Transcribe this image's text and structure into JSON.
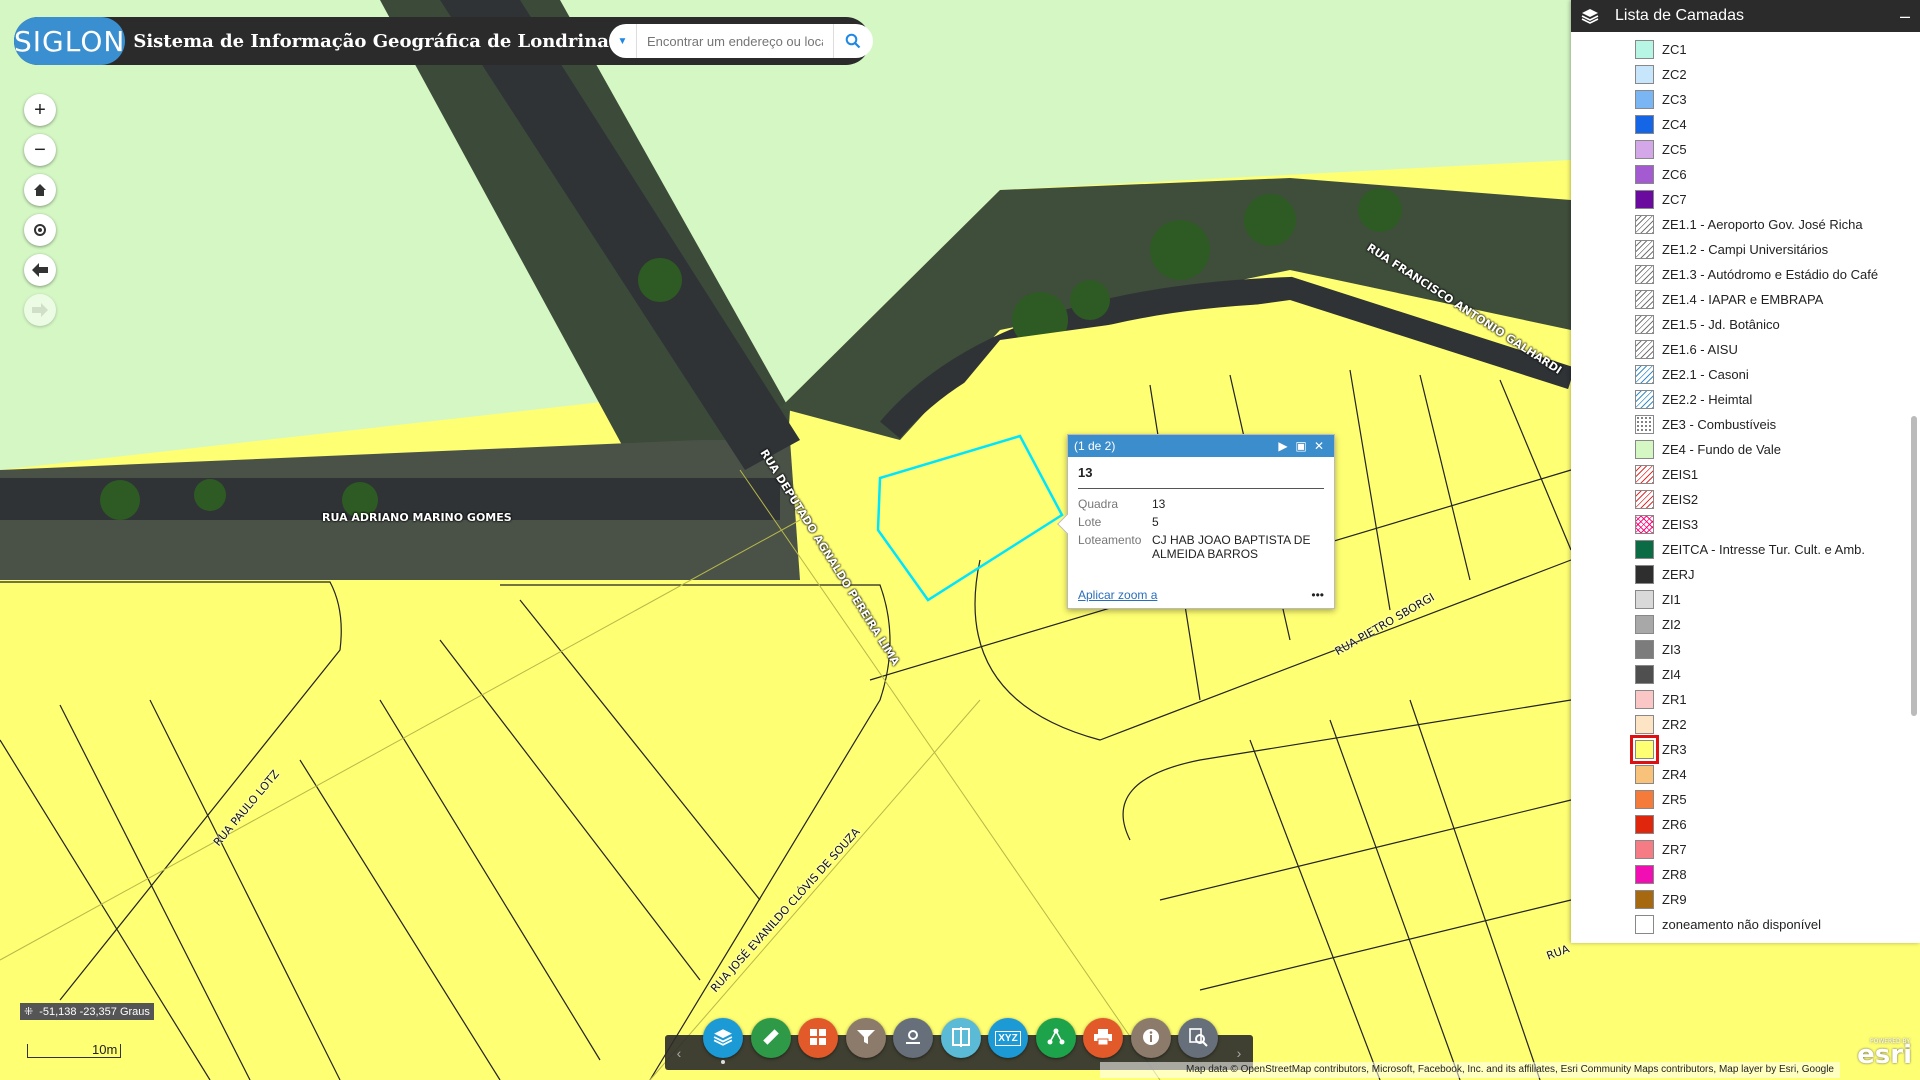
{
  "header": {
    "logo_text": "SIGLON",
    "app_title": "Sistema de Informação Geográfica de Londrina",
    "search_placeholder": "Encontrar um endereço ou local"
  },
  "map_tools": {
    "zoom_in": "+",
    "zoom_out": "−"
  },
  "street_labels": [
    "RUA ADRIANO MARINO GOMES",
    "RUA DEPUTADO AGNALDO PEREIRA LIMA",
    "RUA FRANCISCO ANTONIO GALHARDI",
    "RUA PIETRO SBORGI",
    "RUA PAULO LOTZ",
    "RUA JOSÉ EVANILDO CLÓVIS DE SOUZA",
    "RUA"
  ],
  "popup": {
    "counter": "(1 de 2)",
    "title": "13",
    "fields": [
      {
        "key": "Quadra",
        "value": "13"
      },
      {
        "key": "Lote",
        "value": "5"
      },
      {
        "key": "Loteamento",
        "value": "CJ HAB JOAO BAPTISTA DE ALMEIDA BARROS"
      }
    ],
    "zoom_link": "Aplicar zoom a",
    "more": "•••"
  },
  "layer_panel": {
    "title": "Lista de Camadas",
    "close": "–",
    "items": [
      {
        "label": "ZC1",
        "color": "#b7f5e4",
        "pattern": "solid"
      },
      {
        "label": "ZC2",
        "color": "#c8e6fb",
        "pattern": "solid"
      },
      {
        "label": "ZC3",
        "color": "#7ab6f4",
        "pattern": "solid"
      },
      {
        "label": "ZC4",
        "color": "#1466e6",
        "pattern": "solid"
      },
      {
        "label": "ZC5",
        "color": "#d3a7e8",
        "pattern": "solid"
      },
      {
        "label": "ZC6",
        "color": "#a45ad0",
        "pattern": "solid"
      },
      {
        "label": "ZC7",
        "color": "#6b0a9e",
        "pattern": "solid"
      },
      {
        "label": "ZE1.1 - Aeroporto Gov. José Richa",
        "color": "#ffffff",
        "pattern": "hatch"
      },
      {
        "label": "ZE1.2 - Campi Universitários",
        "color": "#ffffff",
        "pattern": "hatch"
      },
      {
        "label": "ZE1.3 - Autódromo e Estádio do Café",
        "color": "#ffffff",
        "pattern": "hatch"
      },
      {
        "label": "ZE1.4 - IAPAR e EMBRAPA",
        "color": "#ffffff",
        "pattern": "hatch"
      },
      {
        "label": "ZE1.5 - Jd. Botânico",
        "color": "#ffffff",
        "pattern": "hatch"
      },
      {
        "label": "ZE1.6 - AISU",
        "color": "#ffffff",
        "pattern": "hatch"
      },
      {
        "label": "ZE2.1 - Casoni",
        "color": "#ffffff",
        "pattern": "hatch-blue"
      },
      {
        "label": "ZE2.2 - Heimtal",
        "color": "#ffffff",
        "pattern": "hatch-blue"
      },
      {
        "label": "ZE3 - Combustíveis",
        "color": "#ffffff",
        "pattern": "dots"
      },
      {
        "label": "ZE4 - Fundo de Vale",
        "color": "#d4f7c4",
        "pattern": "solid"
      },
      {
        "label": "ZEIS1",
        "color": "#ffffff",
        "pattern": "hatch-red"
      },
      {
        "label": "ZEIS2",
        "color": "#ffffff",
        "pattern": "hatch-red"
      },
      {
        "label": "ZEIS3",
        "color": "#ffffff",
        "pattern": "hatch-pink"
      },
      {
        "label": "ZEITCA - Intresse Tur. Cult. e Amb.",
        "color": "#0b6b45",
        "pattern": "solid"
      },
      {
        "label": "ZERJ",
        "color": "#2e2e2e",
        "pattern": "solid"
      },
      {
        "label": "ZI1",
        "color": "#d9d9d9",
        "pattern": "solid"
      },
      {
        "label": "ZI2",
        "color": "#a8a8a8",
        "pattern": "solid"
      },
      {
        "label": "ZI3",
        "color": "#7c7c7c",
        "pattern": "solid"
      },
      {
        "label": "ZI4",
        "color": "#4f4f4f",
        "pattern": "solid"
      },
      {
        "label": "ZR1",
        "color": "#fbc6c6",
        "pattern": "solid"
      },
      {
        "label": "ZR2",
        "color": "#fde4c4",
        "pattern": "solid"
      },
      {
        "label": "ZR3",
        "color": "#ffff73",
        "pattern": "solid",
        "selected": true
      },
      {
        "label": "ZR4",
        "color": "#f8c27b",
        "pattern": "solid"
      },
      {
        "label": "ZR5",
        "color": "#f47b3a",
        "pattern": "solid"
      },
      {
        "label": "ZR6",
        "color": "#e0260d",
        "pattern": "solid"
      },
      {
        "label": "ZR7",
        "color": "#f57c84",
        "pattern": "solid"
      },
      {
        "label": "ZR8",
        "color": "#f10fb4",
        "pattern": "solid"
      },
      {
        "label": "ZR9",
        "color": "#a6690f",
        "pattern": "solid"
      },
      {
        "label": "zoneamento não disponível",
        "color": "#ffffff",
        "pattern": "solid"
      }
    ]
  },
  "status": {
    "coordinates": "-51,138 -23,357 Graus",
    "scale_label": "10m"
  },
  "toolbar": {
    "buttons": [
      {
        "name": "layers",
        "color": "#1c9ad6"
      },
      {
        "name": "measure",
        "color": "#2e9a48"
      },
      {
        "name": "basemap-gallery",
        "color": "#e2592a"
      },
      {
        "name": "filter",
        "color": "#8c7a6b"
      },
      {
        "name": "location",
        "color": "#666f7a"
      },
      {
        "name": "swipe",
        "color": "#5bbad5"
      },
      {
        "name": "xyz-coordinates",
        "color": "#1c9ad6"
      },
      {
        "name": "share",
        "color": "#1da34a"
      },
      {
        "name": "print",
        "color": "#e2592a"
      },
      {
        "name": "about",
        "color": "#8c7a6b"
      },
      {
        "name": "query",
        "color": "#666f7a"
      }
    ],
    "xyz_text": "XYZ"
  },
  "attribution": "Map data © OpenStreetMap contributors, Microsoft, Facebook, Inc. and its affiliates, Esri Community Maps contributors, Map layer by Esri, Google",
  "esri": {
    "powered": "POWERED BY",
    "brand": "esri"
  },
  "colors": {
    "zone_yellow": "#ffff73",
    "zone_green": "#d4f7c4",
    "highlight": "#00e5ff",
    "header_bg": "#2b2b2b"
  }
}
